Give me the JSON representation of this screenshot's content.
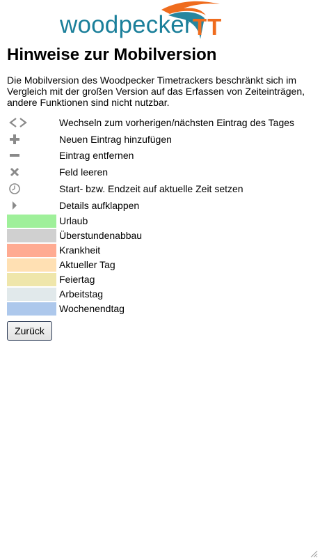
{
  "logo": {
    "word": "woodpecker",
    "suffix": "TT",
    "colors": {
      "word": "#1a7f9a",
      "suffix": "#ef6c1e"
    }
  },
  "title": "Hinweise zur Mobilversion",
  "intro": "Die Mobilversion des Woodpecker Timetrackers beschränkt sich im Vergleich mit der großen Version auf das Erfassen von Zeiteinträgen, andere Funktionen sind nicht nutzbar.",
  "icon_legend": [
    {
      "icon": "prev-next-chevrons-icon",
      "label": "Wechseln zum vorherigen/nächsten Eintrag des Tages"
    },
    {
      "icon": "plus-icon",
      "label": "Neuen Eintrag hinzufügen"
    },
    {
      "icon": "minus-icon",
      "label": "Eintrag entfernen"
    },
    {
      "icon": "close-icon",
      "label": "Feld leeren"
    },
    {
      "icon": "clock-icon",
      "label": "Start- bzw. Endzeit auf aktuelle Zeit setzen"
    },
    {
      "icon": "caret-right-icon",
      "label": "Details aufklappen"
    }
  ],
  "color_legend": [
    {
      "label": "Urlaub",
      "color": "#9ff09a"
    },
    {
      "label": "Überstundenabbau",
      "color": "#d0d0d0"
    },
    {
      "label": "Krankheit",
      "color": "#ffab92"
    },
    {
      "label": "Aktueller Tag",
      "color": "#ffe0b3"
    },
    {
      "label": "Feiertag",
      "color": "#efe6ab"
    },
    {
      "label": "Arbeitstag",
      "color": "#e1e9eb"
    },
    {
      "label": "Wochenendtag",
      "color": "#adc8ec"
    }
  ],
  "back_button": "Zurück"
}
